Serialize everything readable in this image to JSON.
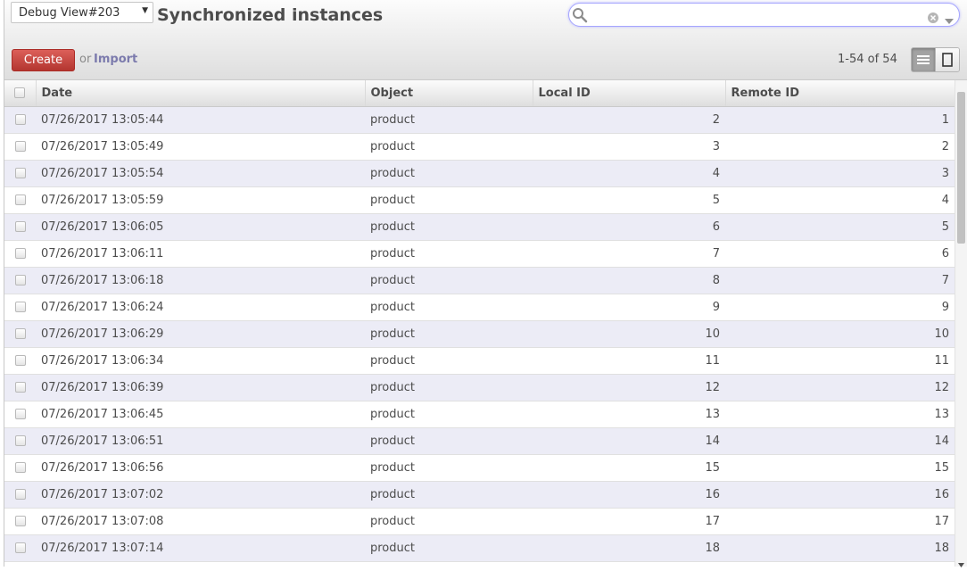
{
  "view_selector": {
    "label": "Debug View#203"
  },
  "page": {
    "title": "Synchronized instances"
  },
  "search": {
    "value": "",
    "placeholder": ""
  },
  "toolbar": {
    "create_label": "Create",
    "or_text": "or",
    "import_label": "Import"
  },
  "pager": {
    "text": "1-54 of 54"
  },
  "view_switch": {
    "active": "list",
    "options": [
      "list-view",
      "form-view"
    ]
  },
  "colors": {
    "create_button": "#c2413b",
    "import_link": "#7c7bad",
    "search_focus": "#a6a6fe",
    "odd_row": "#ececf6"
  },
  "table": {
    "columns": [
      "Date",
      "Object",
      "Local ID",
      "Remote ID"
    ],
    "rows": [
      {
        "date": "07/26/2017 13:05:44",
        "object": "product",
        "local_id": "2",
        "remote_id": "1"
      },
      {
        "date": "07/26/2017 13:05:49",
        "object": "product",
        "local_id": "3",
        "remote_id": "2"
      },
      {
        "date": "07/26/2017 13:05:54",
        "object": "product",
        "local_id": "4",
        "remote_id": "3"
      },
      {
        "date": "07/26/2017 13:05:59",
        "object": "product",
        "local_id": "5",
        "remote_id": "4"
      },
      {
        "date": "07/26/2017 13:06:05",
        "object": "product",
        "local_id": "6",
        "remote_id": "5"
      },
      {
        "date": "07/26/2017 13:06:11",
        "object": "product",
        "local_id": "7",
        "remote_id": "6"
      },
      {
        "date": "07/26/2017 13:06:18",
        "object": "product",
        "local_id": "8",
        "remote_id": "7"
      },
      {
        "date": "07/26/2017 13:06:24",
        "object": "product",
        "local_id": "9",
        "remote_id": "9"
      },
      {
        "date": "07/26/2017 13:06:29",
        "object": "product",
        "local_id": "10",
        "remote_id": "10"
      },
      {
        "date": "07/26/2017 13:06:34",
        "object": "product",
        "local_id": "11",
        "remote_id": "11"
      },
      {
        "date": "07/26/2017 13:06:39",
        "object": "product",
        "local_id": "12",
        "remote_id": "12"
      },
      {
        "date": "07/26/2017 13:06:45",
        "object": "product",
        "local_id": "13",
        "remote_id": "13"
      },
      {
        "date": "07/26/2017 13:06:51",
        "object": "product",
        "local_id": "14",
        "remote_id": "14"
      },
      {
        "date": "07/26/2017 13:06:56",
        "object": "product",
        "local_id": "15",
        "remote_id": "15"
      },
      {
        "date": "07/26/2017 13:07:02",
        "object": "product",
        "local_id": "16",
        "remote_id": "16"
      },
      {
        "date": "07/26/2017 13:07:08",
        "object": "product",
        "local_id": "17",
        "remote_id": "17"
      },
      {
        "date": "07/26/2017 13:07:14",
        "object": "product",
        "local_id": "18",
        "remote_id": "18"
      }
    ]
  }
}
